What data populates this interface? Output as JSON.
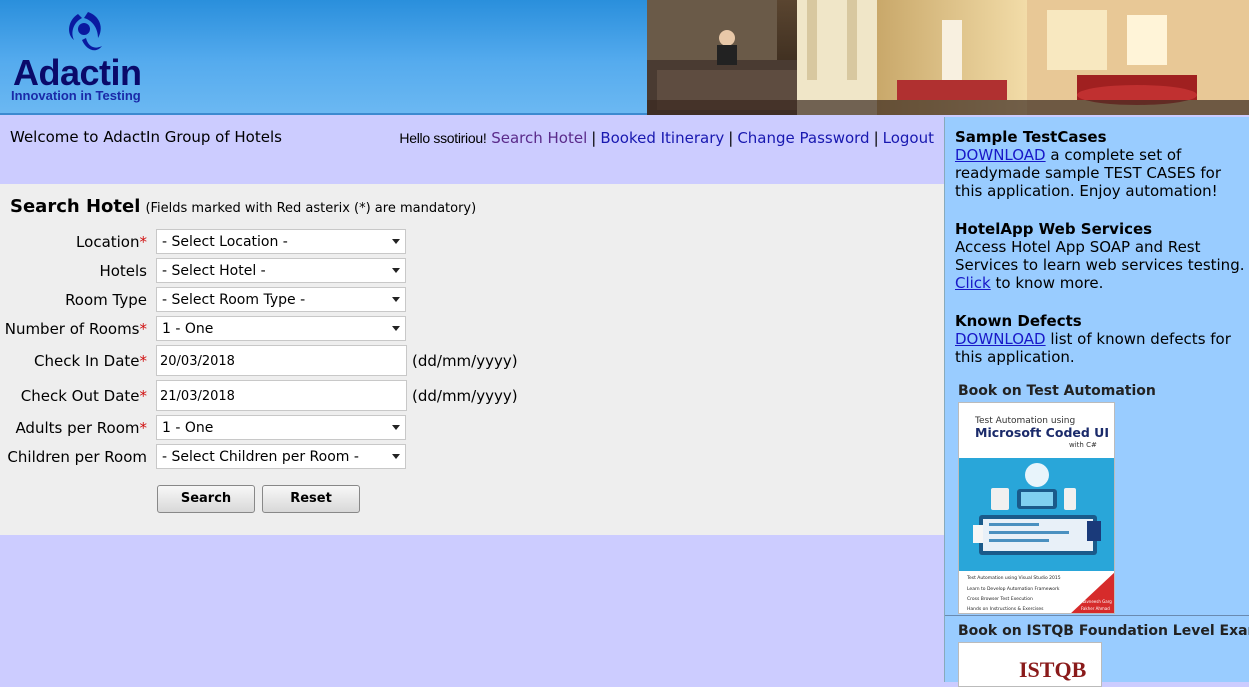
{
  "header": {
    "logo_text": "Adactin",
    "logo_tagline": "Innovation in Testing"
  },
  "welcome_text": "Welcome to AdactIn Group of Hotels",
  "userbar": {
    "hello": "Hello ssotiriou!",
    "links": [
      "Search Hotel",
      "Booked Itinerary",
      "Change Password",
      "Logout"
    ],
    "separator": "|"
  },
  "form": {
    "title": "Search Hotel",
    "note": "(Fields marked with Red asterix (*) are mandatory)",
    "required_marker": "*",
    "fields": {
      "location": {
        "label": "Location",
        "value": "- Select Location -"
      },
      "hotels": {
        "label": "Hotels",
        "value": "- Select Hotel -"
      },
      "room_type": {
        "label": "Room Type",
        "value": "- Select Room Type -"
      },
      "rooms": {
        "label": "Number of Rooms",
        "value": "1 - One"
      },
      "check_in": {
        "label": "Check In Date",
        "value": "20/03/2018",
        "format": "(dd/mm/yyyy)"
      },
      "check_out": {
        "label": "Check Out Date",
        "value": "21/03/2018",
        "format": "(dd/mm/yyyy)"
      },
      "adults": {
        "label": "Adults per Room",
        "value": "1 - One"
      },
      "children": {
        "label": "Children per Room",
        "value": "- Select Children per Room -"
      }
    },
    "search_label": "Search",
    "reset_label": "Reset"
  },
  "sidebar": {
    "testcases": {
      "heading": "Sample TestCases",
      "link": "DOWNLOAD",
      "text": " a complete set of readymade sample TEST CASES for this application. Enjoy automation!"
    },
    "webservices": {
      "heading": "HotelApp Web Services",
      "text_before": "Access Hotel App SOAP and Rest Services to learn web services testing. ",
      "link": "Click",
      "text_after": " to know more."
    },
    "defects": {
      "heading": "Known Defects",
      "link": "DOWNLOAD",
      "text": " list of known defects for this application."
    },
    "book1": {
      "heading": "Book on Test Automation",
      "cover_line1": "Test Automation using",
      "cover_title": "Microsoft Coded UI",
      "cover_sub": "with C#",
      "bullets": [
        "Test Automation using Visual Studio 2015",
        "Learn to Develop Automation Framework",
        "Cross Browser Test Execution",
        "Hands on Instructions & Exercises"
      ],
      "authors": [
        "Navneesh Garg",
        "Fakher Ahmad"
      ]
    },
    "book2": {
      "heading": "Book on ISTQB Foundation Level Exam",
      "cover_title": "ISTQB"
    }
  },
  "colors": {
    "page_bg": "#ccccff",
    "form_bg": "#eeeeee",
    "sidebar_bg": "#99ccff",
    "link": "#1818b0",
    "required": "#d01010"
  }
}
